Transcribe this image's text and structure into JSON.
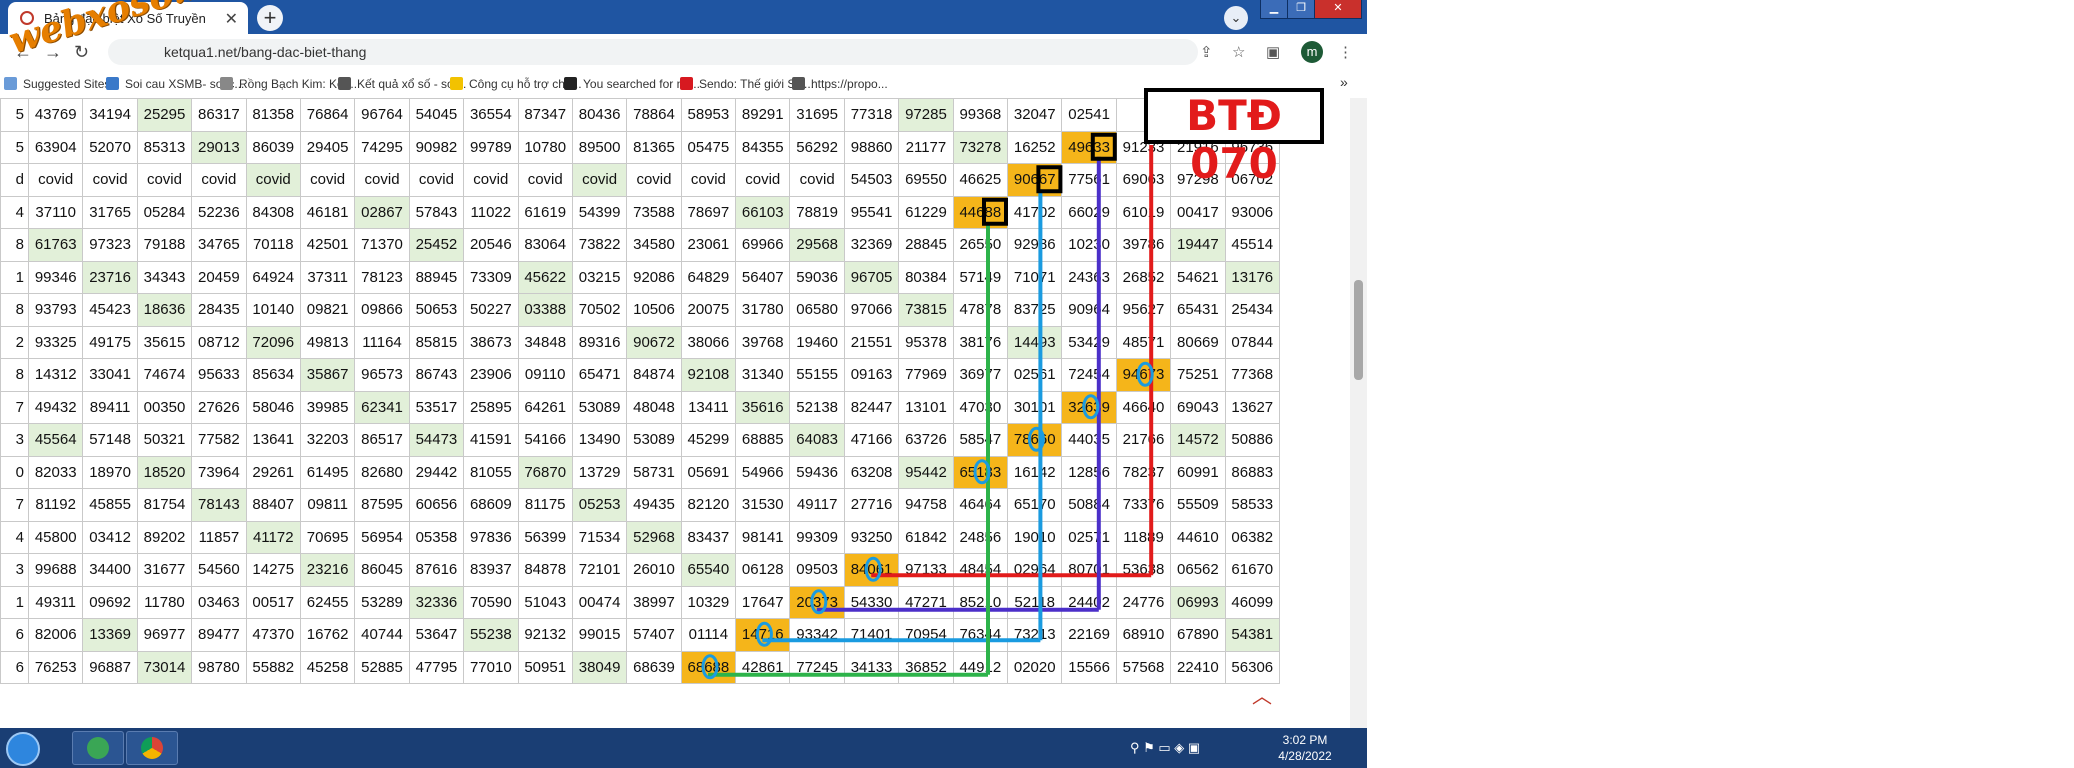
{
  "browser": {
    "tab_title": "Bảng đặc biệt Xổ Số Truyền",
    "url": "ketqua1.net/bang-dac-biet-thang",
    "avatar_letter": "m",
    "bookmarks": [
      {
        "label": "Suggested Sites",
        "color": "#6a9bd8"
      },
      {
        "label": "Soi cau XSMB- soi c...",
        "color": "#3a79c9"
      },
      {
        "label": "Rồng Bạch Kim: Kết...",
        "color": "#888888"
      },
      {
        "label": "Kết quả xổ số - soi...",
        "color": "#555555"
      },
      {
        "label": "Công cụ hỗ trợ cho...",
        "color": "#f2c200"
      },
      {
        "label": "You searched for nh...",
        "color": "#222222"
      },
      {
        "label": "Sendo: Thế giới SH...",
        "color": "#d71920"
      },
      {
        "label": "https://propo...",
        "color": "#555555"
      }
    ],
    "more_bookmarks": "»"
  },
  "watermark": "webxoso.net",
  "annotation": {
    "badge": "BTĐ 070",
    "colors": {
      "red": "#e21b1b",
      "purple": "#4b2fc9",
      "blue": "#1a9be0",
      "green": "#2db34a",
      "ring": "#1a9be0",
      "box": "#000000"
    }
  },
  "table": {
    "rows": [
      [
        "5",
        "43769",
        "34194",
        "25295",
        "86317",
        "81358",
        "76864",
        "96764",
        "54045",
        "36554",
        "87347",
        "80436",
        "78864",
        "58953",
        "89291",
        "31695",
        "77318",
        "97285",
        "99368",
        "32047",
        "02541",
        "",
        "",
        ""
      ],
      [
        "5",
        "63904",
        "52070",
        "85313",
        "29013",
        "86039",
        "29405",
        "74295",
        "90982",
        "99789",
        "10780",
        "89500",
        "81365",
        "05475",
        "84355",
        "56292",
        "98860",
        "21177",
        "73278",
        "16252",
        "49633",
        "91233",
        "21916",
        "96736"
      ],
      [
        "d",
        "covid",
        "covid",
        "covid",
        "covid",
        "covid",
        "covid",
        "covid",
        "covid",
        "covid",
        "covid",
        "covid",
        "covid",
        "covid",
        "covid",
        "covid",
        "54503",
        "69550",
        "46625",
        "90667",
        "77561",
        "69063",
        "97298",
        "06702"
      ],
      [
        "4",
        "37110",
        "31765",
        "05284",
        "52236",
        "84308",
        "46181",
        "02867",
        "57843",
        "11022",
        "61619",
        "54399",
        "73588",
        "78697",
        "66103",
        "78819",
        "95541",
        "61229",
        "44688",
        "41702",
        "66029",
        "61019",
        "00417",
        "93006"
      ],
      [
        "8",
        "61763",
        "97323",
        "79188",
        "34765",
        "70118",
        "42501",
        "71370",
        "25452",
        "20546",
        "83064",
        "73822",
        "34580",
        "23061",
        "69966",
        "29568",
        "32369",
        "28845",
        "26550",
        "92986",
        "10230",
        "39786",
        "19447",
        "45514"
      ],
      [
        "1",
        "99346",
        "23716",
        "34343",
        "20459",
        "64924",
        "37311",
        "78123",
        "88945",
        "73309",
        "45622",
        "03215",
        "92086",
        "64829",
        "56407",
        "59036",
        "96705",
        "80384",
        "57149",
        "71071",
        "24363",
        "26852",
        "54621",
        "13176"
      ],
      [
        "8",
        "93793",
        "45423",
        "18636",
        "28435",
        "10140",
        "09821",
        "09866",
        "50653",
        "50227",
        "03388",
        "70502",
        "10506",
        "20075",
        "31780",
        "06580",
        "97066",
        "73815",
        "47878",
        "83725",
        "90964",
        "95627",
        "65431",
        "25434"
      ],
      [
        "2",
        "93325",
        "49175",
        "35615",
        "08712",
        "72096",
        "49813",
        "11164",
        "85815",
        "38673",
        "34848",
        "89316",
        "90672",
        "38066",
        "39768",
        "19460",
        "21551",
        "95378",
        "38176",
        "14493",
        "53429",
        "48571",
        "80669",
        "07844"
      ],
      [
        "8",
        "14312",
        "33041",
        "74674",
        "95633",
        "85634",
        "35867",
        "96573",
        "86743",
        "23906",
        "09110",
        "65471",
        "84874",
        "92108",
        "31340",
        "55155",
        "09163",
        "77969",
        "36977",
        "02561",
        "72454",
        "94673",
        "75251",
        "77368"
      ],
      [
        "7",
        "49432",
        "89411",
        "00350",
        "27626",
        "58046",
        "39985",
        "62341",
        "53517",
        "25895",
        "64261",
        "53089",
        "48048",
        "13411",
        "35616",
        "52138",
        "82447",
        "13101",
        "47030",
        "30101",
        "32639",
        "46640",
        "69043",
        "13627"
      ],
      [
        "3",
        "45564",
        "57148",
        "50321",
        "77582",
        "13641",
        "32203",
        "86517",
        "54473",
        "41591",
        "54166",
        "13490",
        "53089",
        "45299",
        "68885",
        "64083",
        "47166",
        "63726",
        "58547",
        "78660",
        "44035",
        "21766",
        "14572",
        "50886"
      ],
      [
        "0",
        "82033",
        "18970",
        "18520",
        "73964",
        "29261",
        "61495",
        "82680",
        "29442",
        "81055",
        "76870",
        "13729",
        "58731",
        "05691",
        "54966",
        "59436",
        "63208",
        "95442",
        "65183",
        "16142",
        "12856",
        "78237",
        "60991",
        "86883"
      ],
      [
        "7",
        "81192",
        "45855",
        "81754",
        "78143",
        "88407",
        "09811",
        "87595",
        "60656",
        "68609",
        "81175",
        "05253",
        "49435",
        "82120",
        "31530",
        "49117",
        "27716",
        "94758",
        "46464",
        "65170",
        "50884",
        "73376",
        "55509",
        "58533"
      ],
      [
        "4",
        "45800",
        "03412",
        "89202",
        "11857",
        "41172",
        "70695",
        "56954",
        "05358",
        "97836",
        "56399",
        "71534",
        "52968",
        "83437",
        "98141",
        "99309",
        "93250",
        "61842",
        "24856",
        "19010",
        "02571",
        "11889",
        "44610",
        "06382"
      ],
      [
        "3",
        "99688",
        "34400",
        "31677",
        "54560",
        "14275",
        "23216",
        "86045",
        "87616",
        "83937",
        "84878",
        "72101",
        "26010",
        "65540",
        "06128",
        "09503",
        "84061",
        "97133",
        "48454",
        "02964",
        "80701",
        "53638",
        "06562",
        "61670"
      ],
      [
        "1",
        "49311",
        "09692",
        "11780",
        "03463",
        "00517",
        "62455",
        "53289",
        "32336",
        "70590",
        "51043",
        "00474",
        "38997",
        "10329",
        "17647",
        "20373",
        "54330",
        "47271",
        "85210",
        "52118",
        "24402",
        "24776",
        "06993",
        "46099"
      ],
      [
        "6",
        "82006",
        "13369",
        "96977",
        "89477",
        "47370",
        "16762",
        "40744",
        "53647",
        "55238",
        "92132",
        "99015",
        "57407",
        "01114",
        "14716",
        "93342",
        "71401",
        "70954",
        "76344",
        "73213",
        "22169",
        "68910",
        "67890",
        "54381"
      ],
      [
        "6",
        "76253",
        "96887",
        "73014",
        "98780",
        "55882",
        "45258",
        "52885",
        "47795",
        "77010",
        "50951",
        "38049",
        "68639",
        "68688",
        "42861",
        "77245",
        "34133",
        "36852",
        "44912",
        "02020",
        "15566",
        "57568",
        "22410",
        "56306"
      ]
    ],
    "highlights": {
      "green": [
        "0,3",
        "0,17",
        "1,4",
        "1,18",
        "2,5",
        "2,11",
        "3,7",
        "3,14",
        "4,1",
        "4,8",
        "4,15",
        "4,22",
        "5,2",
        "5,10",
        "5,16",
        "5,23",
        "6,3",
        "6,10",
        "6,17",
        "7,5",
        "7,12",
        "7,19",
        "8,6",
        "8,13",
        "9,7",
        "9,14",
        "10,1",
        "10,8",
        "10,15",
        "10,22",
        "11,3",
        "11,10",
        "11,17",
        "12,4",
        "12,11",
        "13,5",
        "13,12",
        "14,6",
        "14,13",
        "15,8",
        "15,22",
        "16,2",
        "16,9",
        "16,23",
        "17,3",
        "17,11"
      ],
      "orange": [
        "1,20",
        "2,19",
        "3,18",
        "8,21",
        "9,20",
        "10,19",
        "11,18",
        "14,16",
        "15,15",
        "16,14",
        "17,13"
      ]
    }
  },
  "taskbar": {
    "clock_time": "3:02 PM",
    "clock_date": "4/28/2022"
  }
}
